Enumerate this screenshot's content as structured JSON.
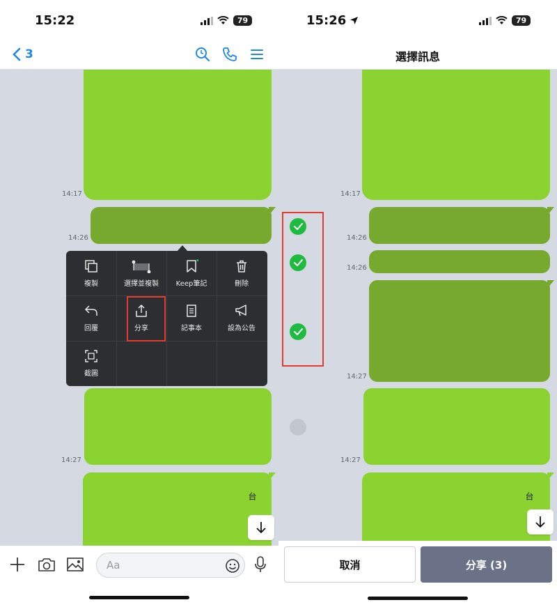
{
  "left": {
    "status": {
      "time": "15:22",
      "battery": "79"
    },
    "nav": {
      "back_count": "3"
    },
    "timestamps": [
      "14:17",
      "14:26",
      "14:27"
    ],
    "menu": {
      "items": [
        "複製",
        "選擇並複製",
        "Keep筆記",
        "刪除",
        "回覆",
        "分享",
        "記事本",
        "設為公告",
        "截圖"
      ]
    },
    "input": {
      "placeholder": "Aa"
    },
    "bubble_text": {
      "side_char": "台"
    }
  },
  "right": {
    "status": {
      "time": "15:26",
      "battery": "79"
    },
    "nav": {
      "title": "選擇訊息"
    },
    "timestamps": [
      "14:17",
      "14:26",
      "14:26",
      "14:27",
      "14:27"
    ],
    "bubble_text": {
      "side_char": "台"
    },
    "buttons": {
      "cancel": "取消",
      "share": "分享 (3)"
    }
  },
  "colors": {
    "bubble_green": "#8bd331",
    "bubble_selected": "#76a92e",
    "chat_bg": "#d5dae2",
    "accent_blue": "#1e88e5",
    "check_green": "#1fba40",
    "highlight_red": "#e53a2e",
    "share_button": "#6b7287",
    "menu_bg": "#2c2e31"
  }
}
